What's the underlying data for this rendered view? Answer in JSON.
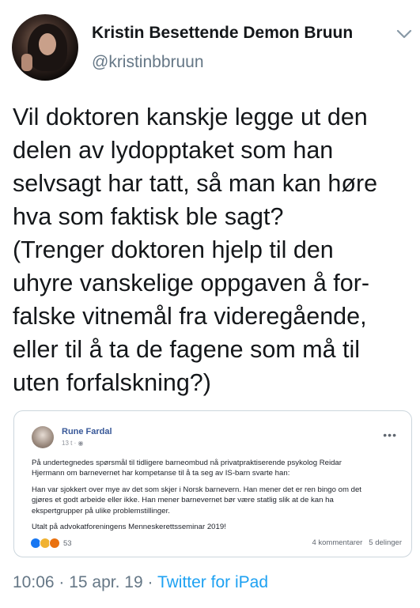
{
  "author": {
    "name": "Kristin Besettende Demon Bruun",
    "handle": "@kristinbbruun"
  },
  "tweet": {
    "lines": [
      "Vil doktoren kanskje legge ut den",
      "delen av lydopptaket som han",
      "selvsagt har tatt, så man kan høre",
      "hva som faktisk ble sagt?",
      "(Trenger doktoren hjelp til den",
      "uhyre vanskelige oppgaven å for-",
      "falske vitnemål fra videregående,",
      "eller til å ta de fagene som må til",
      "uten forfalskning?)"
    ]
  },
  "embed": {
    "author": "Rune Fardal",
    "meta": "13 t · ◉",
    "paragraphs": [
      [
        "På undertegnedes spørsmål til tidligere barneombud nå privatpraktiserende psykolog Reidar",
        "Hjermann om barnevernet har kompetanse til å ta seg av IS-barn svarte han:"
      ],
      [
        "Han var sjokkert over mye av det som skjer i Norsk barnevern. Han mener det er ren bingo om det",
        "gjøres et godt arbeide eller ikke. Han mener barnevernet bør være statlig slik at de kan ha",
        "ekspertgrupper på ulike problemstillinger."
      ],
      [
        "Utalt på advokatforeningens Menneskerettsseminar 2019!"
      ]
    ],
    "reactions_count": "53",
    "comments": "4 kommentarer",
    "shares": "5 delinger"
  },
  "footer": {
    "time": "10:06",
    "sep1": " · ",
    "date": "15 apr. 19",
    "sep2": " · ",
    "source": "Twitter for iPad"
  },
  "colors": {
    "text": "#14171a",
    "secondary": "#657786",
    "link": "#1da1f2",
    "facebook_blue": "#385898"
  },
  "icons": {
    "menu": "chevron-down-icon",
    "embed_menu": "more-options-icon"
  }
}
